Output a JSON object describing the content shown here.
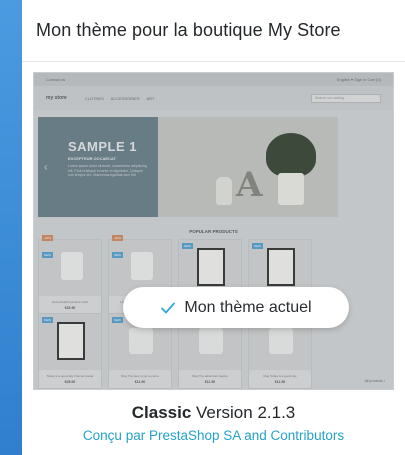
{
  "card": {
    "title": "Mon thème pour la boutique My Store",
    "current_label": "Mon thème actuel",
    "theme_name": "Classic",
    "theme_version": "Version 2.1.3",
    "author": "Conçu par PrestaShop SA and Contributors"
  },
  "preview": {
    "top_left": "Contact us",
    "top_right": "English ▾   Sign in   Cart (0)",
    "logo": "my store",
    "menu": [
      "CLOTHES",
      "ACCESSORIES",
      "ART"
    ],
    "search_placeholder": "Search our catalog",
    "hero_title": "SAMPLE 1",
    "hero_subtitle": "EXCEPTEUR OCCAECAT",
    "hero_text": "Lorem ipsum dolor sit amet, consectetur adipiscing elit. Proin tristique in tortor et dignissim. Quisque non tempor leo. Maecenas egestas sem elit",
    "popular_title": "POPULAR PRODUCTS",
    "products_row1": [
      {
        "name": "Hummingbird printed t-shirt",
        "price": "€23.90",
        "tag": "NEW",
        "off": "-20%"
      },
      {
        "name": "Hummingbird printed sweater",
        "price": "€28.72",
        "tag": "NEW",
        "off": "-20%"
      },
      {
        "name": "The best is yet to come' Framed poster",
        "price": "€29.00",
        "tag": "NEW",
        "off": ""
      },
      {
        "name": "The adventure begins Framed poster",
        "price": "€29.00",
        "tag": "NEW",
        "off": ""
      }
    ],
    "products_row2": [
      {
        "name": "Today is a good day Framed poster",
        "price": "€29.00",
        "tag": "NEW"
      },
      {
        "name": "Mug The best is yet to come",
        "price": "€11.90",
        "tag": "NEW"
      },
      {
        "name": "Mug The adventure begins",
        "price": "€11.90",
        "tag": "NEW"
      },
      {
        "name": "Mug Today is a good day",
        "price": "€11.90",
        "tag": "NEW"
      }
    ],
    "all_products": "All products ›"
  },
  "colors": {
    "background": "#3d8ed8",
    "accent": "#24a2c9",
    "check": "#2fa9d6"
  }
}
